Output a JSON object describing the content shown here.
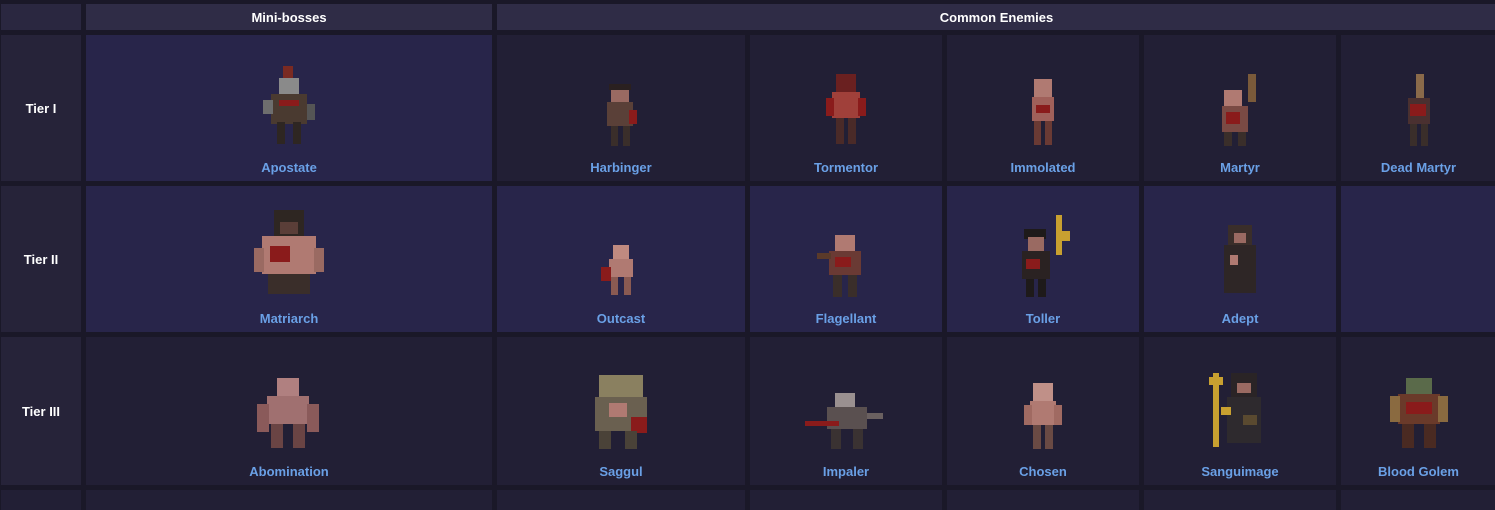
{
  "header": {
    "minibosses": "Mini-bosses",
    "common": "Common Enemies"
  },
  "tiers": [
    {
      "label": "Tier I",
      "miniboss": "Apostate",
      "enemies": [
        "Harbinger",
        "Tormentor",
        "Immolated",
        "Martyr",
        "Dead Martyr"
      ]
    },
    {
      "label": "Tier II",
      "miniboss": "Matriarch",
      "enemies": [
        "Outcast",
        "Flagellant",
        "Toller",
        "Adept",
        ""
      ]
    },
    {
      "label": "Tier III",
      "miniboss": "Abomination",
      "enemies": [
        "Saggul",
        "Impaler",
        "Chosen",
        "Sanguimage",
        "Blood Golem"
      ]
    }
  ],
  "sprites": {
    "Apostate": "hooded-cultist-sprite",
    "Harbinger": "ghoul-sprite",
    "Tormentor": "flayed-sprite",
    "Immolated": "burned-sprite",
    "Martyr": "torch-bearer-sprite",
    "Dead Martyr": "torch-bearer-dead-sprite",
    "Matriarch": "bloated-hag-sprite",
    "Outcast": "crawler-sprite",
    "Flagellant": "whip-sprite",
    "Toller": "bell-ringer-sprite",
    "Adept": "robed-monk-sprite",
    "Abomination": "hunched-brute-sprite",
    "Saggul": "sack-beast-sprite",
    "Impaler": "spear-beast-sprite",
    "Chosen": "pale-ghoul-sprite",
    "Sanguimage": "staff-mage-sprite",
    "Blood Golem": "golem-sprite"
  },
  "colors": {
    "link": "#6aa0e6",
    "header_bg": "#2f2c46",
    "cell_bg": "#221f35",
    "blood": "#8a1b1b",
    "flesh": "#b07a72"
  }
}
